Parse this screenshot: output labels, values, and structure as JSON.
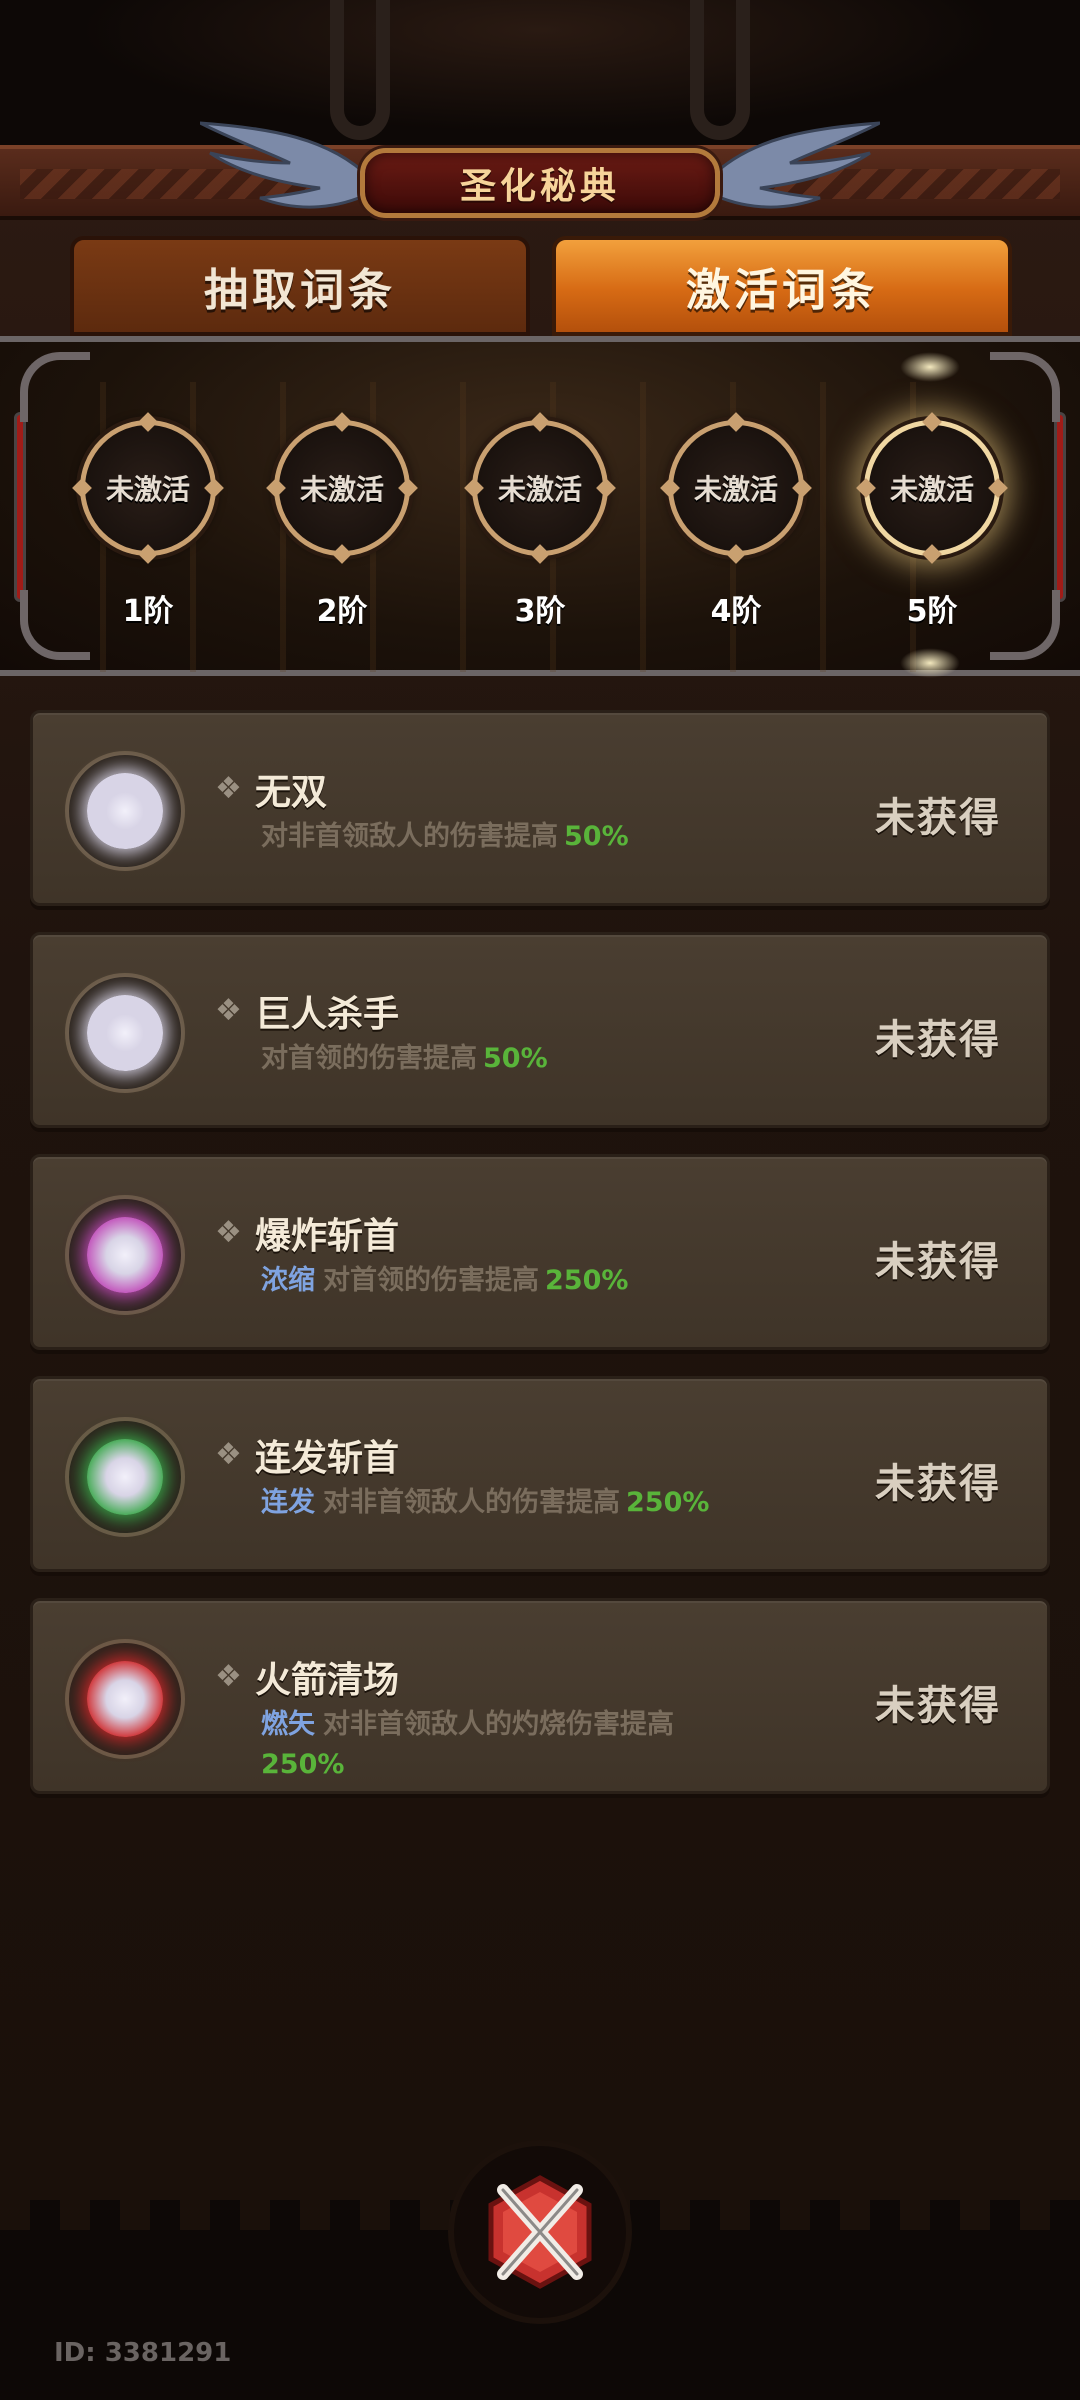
{
  "header": {
    "title": "圣化秘典"
  },
  "tabs": [
    {
      "label": "抽取词条",
      "active": false
    },
    {
      "label": "激活词条",
      "active": true
    }
  ],
  "tiers": [
    {
      "status": "未激活",
      "label": "1阶"
    },
    {
      "status": "未激活",
      "label": "2阶"
    },
    {
      "status": "未激活",
      "label": "3阶"
    },
    {
      "status": "未激活",
      "label": "4阶"
    },
    {
      "status": "未激活",
      "label": "5阶",
      "highlighted": true
    }
  ],
  "affixes": [
    {
      "name": "无双",
      "tag": "",
      "desc": "对非首领敌人的伤害提高",
      "value": "50%",
      "status": "未获得",
      "orb_color": "#d8d4e6"
    },
    {
      "name": "巨人杀手",
      "tag": "",
      "desc": "对首领的伤害提高",
      "value": "50%",
      "status": "未获得",
      "orb_color": "#d8d4e6"
    },
    {
      "name": "爆炸斩首",
      "tag": "浓缩",
      "desc": "对首领的伤害提高",
      "value": "250%",
      "status": "未获得",
      "orb_color": "#c04ab8"
    },
    {
      "name": "连发斩首",
      "tag": "连发",
      "desc": "对非首领敌人的伤害提高",
      "value": "250%",
      "status": "未获得",
      "orb_color": "#3aa84a"
    },
    {
      "name": "火箭清场",
      "tag": "燃矢",
      "desc": "对非首领敌人的灼烧伤害提高",
      "value": "250%",
      "status": "未获得",
      "orb_color": "#d0282a"
    }
  ],
  "footer": {
    "id_text": "ID: 3381291",
    "close_icon": "close-x-icon"
  },
  "colors": {
    "accent_orange": "#e07a1c",
    "value_green": "#59b43a",
    "tag_blue": "#7fa3e0"
  }
}
